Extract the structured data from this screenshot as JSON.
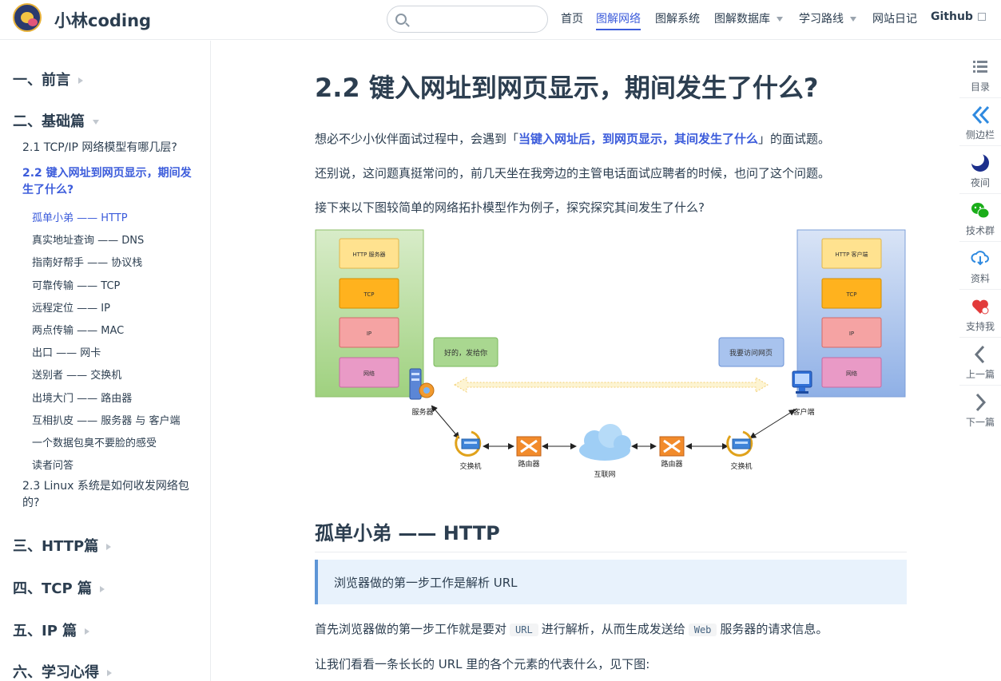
{
  "navbar": {
    "site_name": "小林coding",
    "search_placeholder": "",
    "items": [
      {
        "label": "首页"
      },
      {
        "label": "图解网络"
      },
      {
        "label": "图解系统"
      },
      {
        "label": "图解数据库"
      },
      {
        "label": "学习路线"
      },
      {
        "label": "网站日记"
      },
      {
        "label": "Github"
      }
    ]
  },
  "sidebar": {
    "sections": [
      {
        "label": "一、前言"
      },
      {
        "label": "二、基础篇"
      },
      {
        "label": "三、HTTP篇"
      },
      {
        "label": "四、TCP 篇"
      },
      {
        "label": "五、IP 篇"
      },
      {
        "label": "六、学习心得"
      }
    ],
    "pages": [
      {
        "label": "2.1 TCP/IP 网络模型有哪几层?"
      },
      {
        "label": "2.2 键入网址到网页显示，期间发生了什么?"
      },
      {
        "label": "2.3 Linux 系统是如何收发网络包的?"
      }
    ],
    "headings": [
      {
        "label": "孤单小弟 —— HTTP"
      },
      {
        "label": "真实地址查询 —— DNS"
      },
      {
        "label": "指南好帮手 —— 协议栈"
      },
      {
        "label": "可靠传输 —— TCP"
      },
      {
        "label": "远程定位 —— IP"
      },
      {
        "label": "两点传输 —— MAC"
      },
      {
        "label": "出口 —— 网卡"
      },
      {
        "label": "送别者 —— 交换机"
      },
      {
        "label": "出境大门 —— 路由器"
      },
      {
        "label": "互相扒皮 —— 服务器 与 客户端"
      },
      {
        "label": "一个数据包臭不要脸的感受"
      },
      {
        "label": "读者问答"
      }
    ]
  },
  "article": {
    "title": "2.2 键入网址到网页显示，期间发生了什么?",
    "p1_pre": "想必不少小伙伴面试过程中，会遇到「",
    "p1_hl": "当键入网址后，到网页显示，其间发生了什么",
    "p1_post": "」的面试题。",
    "p2": "还别说，这问题真挺常问的，前几天坐在我旁边的主管电话面试应聘者的时候，也问了这个问题。",
    "p3": "接下来以下图较简单的网络拓扑模型作为例子，探究探究其间发生了什么?",
    "h2": "孤单小弟 —— HTTP",
    "tip": "浏览器做的第一步工作是解析 URL",
    "p4_pre": "首先浏览器做的第一步工作就是要对",
    "p4_code1": "URL",
    "p4_mid": "进行解析，从而生成发送给",
    "p4_code2": "Web",
    "p4_post": "服务器的请求信息。",
    "p5": "让我们看看一条长长的 URL 里的各个元素的代表什么，见下图:"
  },
  "diagram": {
    "server_layers": [
      "HTTP 服务器",
      "TCP",
      "IP",
      "网络"
    ],
    "client_layers": [
      "HTTP 客户端",
      "TCP",
      "IP",
      "网络"
    ],
    "server_bubble": "好的，发给你",
    "client_bubble": "我要访问网页",
    "server_label": "服务器",
    "client_label": "客户端",
    "switch_left": "交换机",
    "router_left": "路由器",
    "internet": "互联网",
    "router_right": "路由器",
    "switch_right": "交换机",
    "colors": {
      "server_bg": "#c7e3b4",
      "client_bg": "#bcd0f0",
      "http": "#ffe28f",
      "tcp": "#ffb21e",
      "ip": "#f5a3a3",
      "net": "#e99ac6"
    }
  },
  "toolbar": {
    "items": [
      {
        "label": "目录",
        "icon": "list-icon"
      },
      {
        "label": "侧边栏",
        "icon": "double-chevron-left-icon"
      },
      {
        "label": "夜间",
        "icon": "moon-icon"
      },
      {
        "label": "技术群",
        "icon": "wechat-icon"
      },
      {
        "label": "资料",
        "icon": "cloud-download-icon"
      },
      {
        "label": "支持我",
        "icon": "heart-icon"
      },
      {
        "label": "上一篇",
        "icon": "chevron-left-icon"
      },
      {
        "label": "下一篇",
        "icon": "chevron-right-icon"
      }
    ]
  }
}
